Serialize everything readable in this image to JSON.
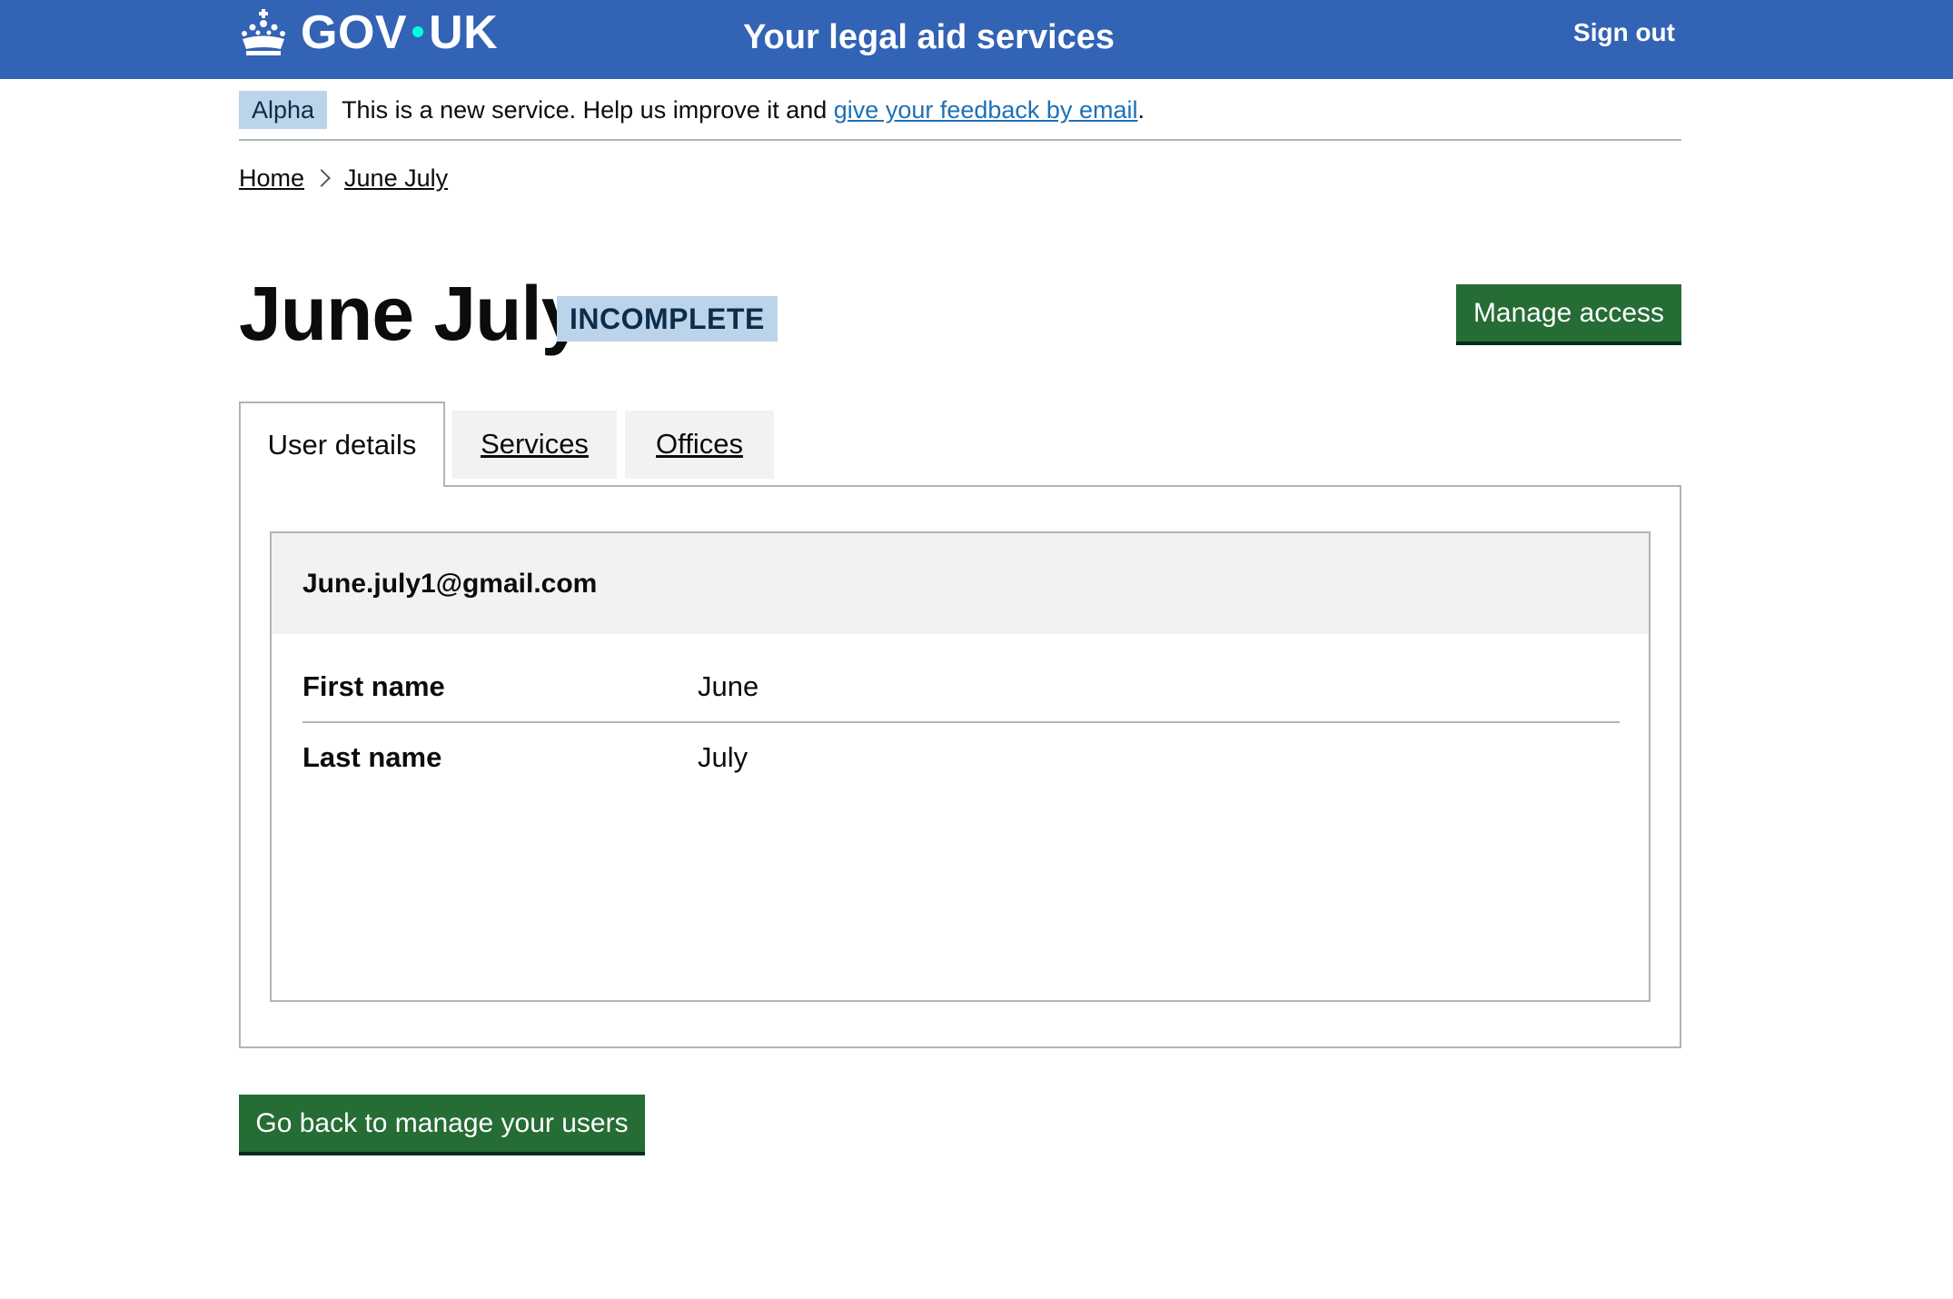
{
  "header": {
    "logo_text_left": "GOV",
    "logo_text_right": "UK",
    "service_name": "Your legal aid services",
    "sign_out": "Sign out"
  },
  "phase_banner": {
    "tag": "Alpha",
    "text": "This is a new service. Help us improve it and ",
    "link": "give your feedback by email",
    "suffix": "."
  },
  "breadcrumb": {
    "items": [
      "Home",
      "June July"
    ]
  },
  "page": {
    "title": "June July",
    "status": "INCOMPLETE",
    "manage_access": "Manage access"
  },
  "tabs": [
    {
      "label": "User details",
      "active": true
    },
    {
      "label": "Services",
      "active": false
    },
    {
      "label": "Offices",
      "active": false
    }
  ],
  "card": {
    "title": "June.july1@gmail.com",
    "rows": [
      {
        "key": "First name",
        "value": "June"
      },
      {
        "key": "Last name",
        "value": "July"
      }
    ]
  },
  "back_button": "Go back to manage your users",
  "colors": {
    "header_bg": "#3263b4",
    "button_green": "#256c35",
    "tag_bg": "#bbd4ea",
    "link": "#1d70b8"
  }
}
